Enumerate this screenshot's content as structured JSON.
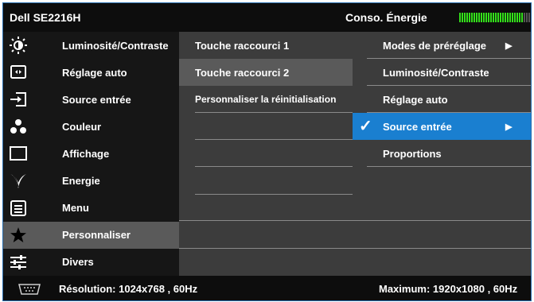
{
  "header": {
    "model": "Dell SE2216H",
    "energy_label": "Conso. Énergie",
    "energy_level": 0.9
  },
  "main_menu": {
    "items": [
      {
        "label": "Luminosité/Contraste",
        "icon": "brightness-icon"
      },
      {
        "label": "Réglage auto",
        "icon": "auto-adjust-icon"
      },
      {
        "label": "Source entrée",
        "icon": "input-source-icon"
      },
      {
        "label": "Couleur",
        "icon": "color-icon"
      },
      {
        "label": "Affichage",
        "icon": "display-icon"
      },
      {
        "label": "Energie",
        "icon": "energy-icon"
      },
      {
        "label": "Menu",
        "icon": "menu-icon"
      },
      {
        "label": "Personnaliser",
        "icon": "star-icon"
      },
      {
        "label": "Divers",
        "icon": "sliders-icon"
      }
    ],
    "selected": "Personnaliser"
  },
  "sub_menu": {
    "items": [
      {
        "label": "Touche raccourci 1"
      },
      {
        "label": "Touche raccourci 2"
      },
      {
        "label": "Personnaliser la réinitialisation"
      }
    ]
  },
  "third_panel": {
    "items": [
      {
        "label": "Modes de préréglage",
        "has_arrow": true
      },
      {
        "label": "Luminosité/Contraste",
        "has_arrow": false
      },
      {
        "label": "Réglage auto",
        "has_arrow": false
      },
      {
        "label": "Source entrée",
        "has_arrow": true,
        "checked": true
      },
      {
        "label": "Proportions",
        "has_arrow": false
      }
    ],
    "arrow_glyph": "▶",
    "check_glyph": "✓"
  },
  "footer": {
    "resolution": "Résolution: 1024x768 , 60Hz",
    "maximum": "Maximum: 1920x1080 , 60Hz"
  },
  "colors": {
    "highlight": "#1a7fd0",
    "energy_active": "#33e01a",
    "energy_inactive": "#555555"
  }
}
